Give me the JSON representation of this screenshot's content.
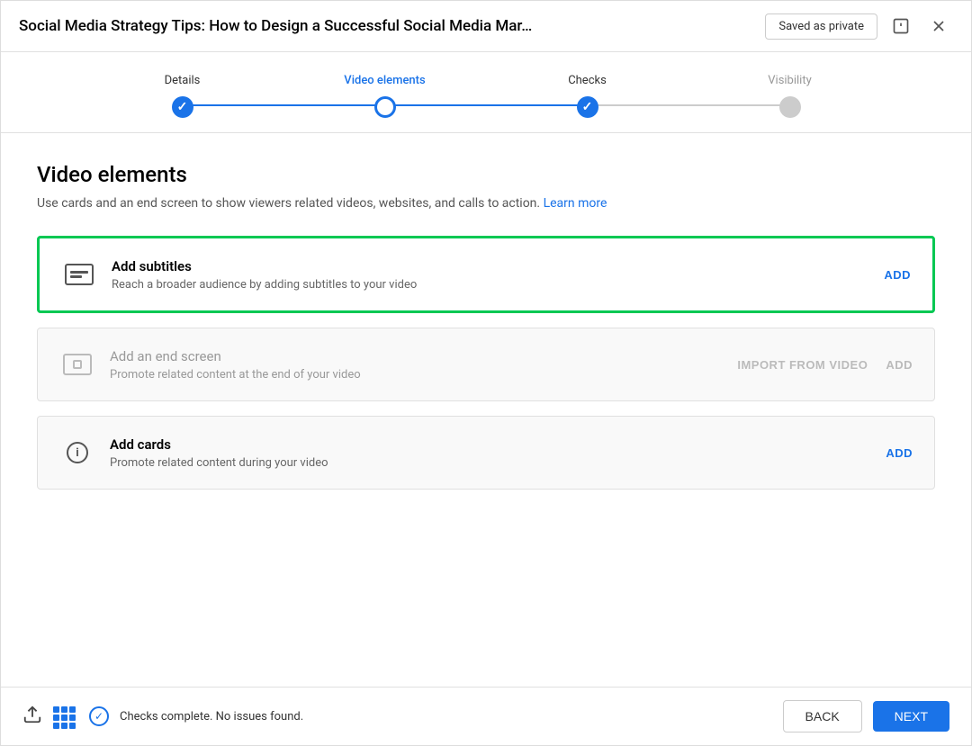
{
  "header": {
    "title": "Social Media Strategy Tips: How to Design a Successful Social Media Mar…",
    "saved_badge": "Saved as private",
    "alert_label": "alert",
    "close_label": "close"
  },
  "stepper": {
    "steps": [
      {
        "id": "details",
        "label": "Details",
        "state": "done"
      },
      {
        "id": "video-elements",
        "label": "Video elements",
        "state": "active"
      },
      {
        "id": "checks",
        "label": "Checks",
        "state": "done"
      },
      {
        "id": "visibility",
        "label": "Visibility",
        "state": "inactive"
      }
    ]
  },
  "page": {
    "title": "Video elements",
    "description": "Use cards and an end screen to show viewers related videos, websites, and calls to action.",
    "learn_more": "Learn more"
  },
  "cards": [
    {
      "id": "subtitles",
      "title": "Add subtitles",
      "subtitle": "Reach a broader audience by adding subtitles to your video",
      "highlighted": true,
      "icon": "subtitle-icon",
      "actions": [
        {
          "label": "ADD",
          "muted": false
        }
      ]
    },
    {
      "id": "end-screen",
      "title": "Add an end screen",
      "subtitle": "Promote related content at the end of your video",
      "highlighted": false,
      "icon": "endscreen-icon",
      "actions": [
        {
          "label": "IMPORT FROM VIDEO",
          "muted": true
        },
        {
          "label": "ADD",
          "muted": true
        }
      ]
    },
    {
      "id": "cards",
      "title": "Add cards",
      "subtitle": "Promote related content during your video",
      "highlighted": false,
      "icon": "info-icon",
      "actions": [
        {
          "label": "ADD",
          "muted": false
        }
      ]
    }
  ],
  "footer": {
    "status_text": "Checks complete. No issues found.",
    "back_label": "BACK",
    "next_label": "NEXT"
  }
}
